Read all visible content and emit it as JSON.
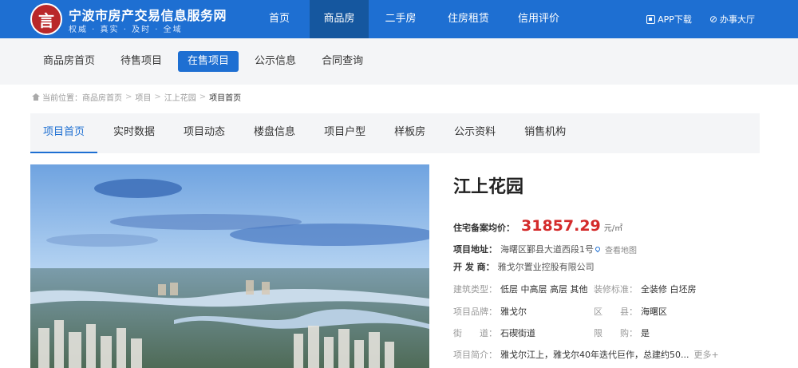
{
  "header": {
    "logo_glyph": "言",
    "site_title": "宁波市房产交易信息服务网",
    "slogan": "权威 · 真实 · 及时 · 全域",
    "nav": [
      {
        "label": "首页",
        "active": false
      },
      {
        "label": "商品房",
        "active": true
      },
      {
        "label": "二手房",
        "active": false
      },
      {
        "label": "住房租赁",
        "active": false
      },
      {
        "label": "信用评价",
        "active": false
      }
    ],
    "app_download": "APP下载",
    "office_hall": "办事大厅",
    "brand_color": "#1e6fd2"
  },
  "subnav": [
    {
      "label": "商品房首页",
      "active": false
    },
    {
      "label": "待售项目",
      "active": false
    },
    {
      "label": "在售项目",
      "active": true
    },
    {
      "label": "公示信息",
      "active": false
    },
    {
      "label": "合同查询",
      "active": false
    }
  ],
  "breadcrumb": {
    "prefix": "当前位置：",
    "items": [
      "商品房首页",
      "项目",
      "江上花园"
    ],
    "current": "项目首页"
  },
  "tabs": [
    {
      "label": "项目首页",
      "active": true
    },
    {
      "label": "实时数据",
      "active": false
    },
    {
      "label": "项目动态",
      "active": false
    },
    {
      "label": "楼盘信息",
      "active": false
    },
    {
      "label": "项目户型",
      "active": false
    },
    {
      "label": "样板房",
      "active": false
    },
    {
      "label": "公示资料",
      "active": false
    },
    {
      "label": "销售机构",
      "active": false
    }
  ],
  "project": {
    "name": "江上花园",
    "price_label": "住宅备案均价：",
    "price": "31857.29",
    "price_unit": "元/㎡",
    "address_label": "项目地址：",
    "address": "海曙区鄞县大道西段1号",
    "map_link": "查看地图",
    "developer_label": "开 发 商：",
    "developer": "雅戈尔置业控股有限公司",
    "building_type_label": "建筑类型：",
    "building_type": "低层 中高层 高层 其他",
    "decoration_label": "装修标准：",
    "decoration": "全装修 白坯房",
    "brand_label": "项目品牌：",
    "brand": "雅戈尔",
    "district_label": "区　　县：",
    "district": "海曙区",
    "street_label": "街　　道：",
    "street": "石碶街道",
    "purchase_limit_label": "限　　购：",
    "purchase_limit": "是",
    "intro_label": "项目简介：",
    "intro": "雅戈尔江上，雅戈尔40年迭代巨作，总建约50...",
    "more": "更多+",
    "price_color": "#d42b2b"
  }
}
